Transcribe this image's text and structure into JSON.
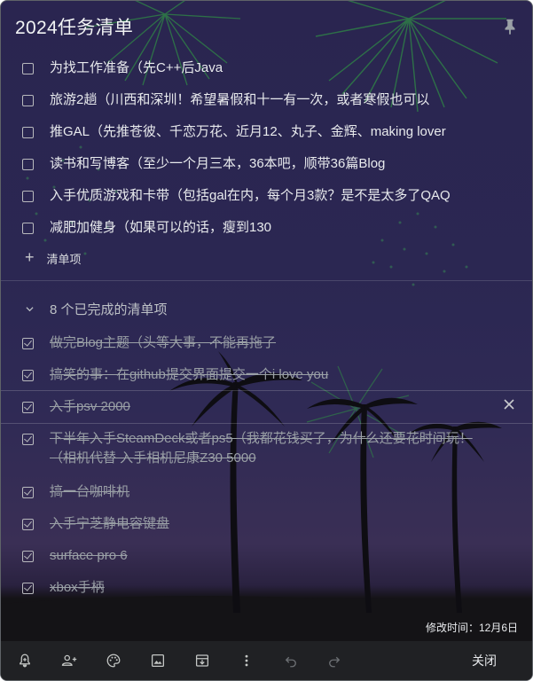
{
  "note": {
    "title": "2024任务清单",
    "active_items": [
      "为找工作准备（先C++后Java",
      "旅游2趟（川西和深圳！希望暑假和十一有一次，或者寒假也可以",
      "推GAL（先推苍彼、千恋万花、近月12、丸子、金辉、making lover",
      "读书和写博客（至少一个月三本，36本吧，顺带36篇Blog",
      "入手优质游戏和卡带（包括gal在内，每个月3款？是不是太多了QAQ",
      "减肥加健身（如果可以的话，瘦到130"
    ],
    "add_item_label": "清单项",
    "completed_header": "8 个已完成的清单项",
    "completed_items": [
      "做完Blog主题（头等大事，不能再拖了",
      "搞笑的事：在github提交界面提交一个i love you",
      "入手psv 2000",
      "下半年入手SteamDeck或者ps5（我都花钱买了，为什么还要花时间玩！（相机代替 入手相机尼康Z30  5000",
      "搞一台咖啡机",
      "入手宁芝静电容键盘",
      "surface pro 6",
      "xbox手柄"
    ],
    "modified": "修改时间：12月6日",
    "close_label": "关闭"
  },
  "icons": {
    "pin": "pin-icon",
    "reminder": "bell-plus-icon",
    "collaborator": "person-add-icon",
    "background": "palette-icon",
    "image": "image-icon",
    "archive": "archive-icon",
    "more": "more-vert-icon",
    "undo": "undo-icon",
    "redo": "redo-icon"
  }
}
